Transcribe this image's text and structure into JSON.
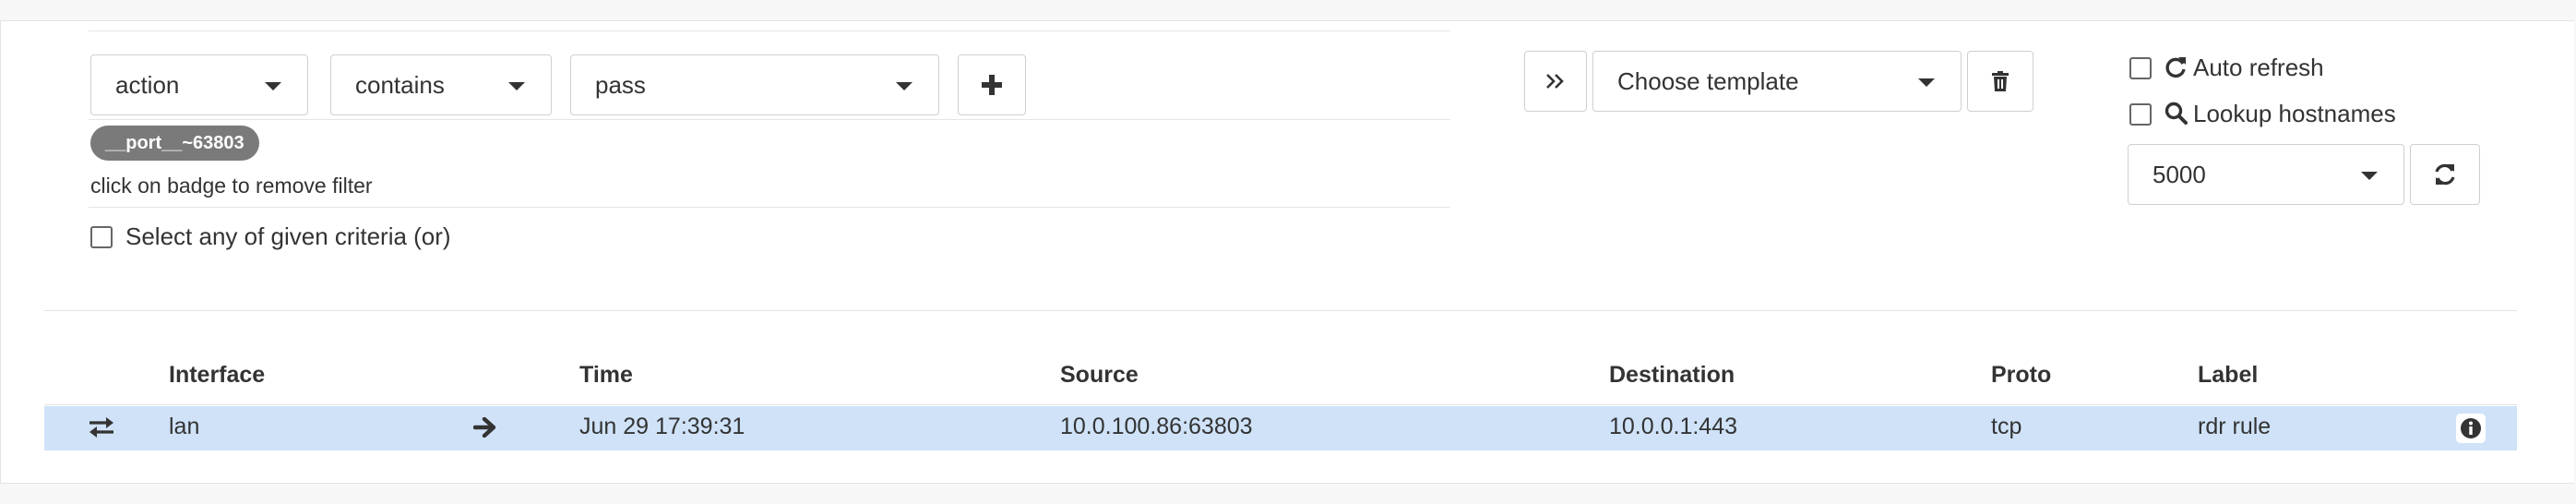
{
  "filters": {
    "field_select": "action",
    "operator_select": "contains",
    "value_select": "pass",
    "active_badge": "__port__~63803",
    "badge_hint": "click on badge to remove filter",
    "or_criteria_label": "Select any of given criteria (or)"
  },
  "templates": {
    "placeholder": "Choose template"
  },
  "options": {
    "auto_refresh_label": "Auto refresh",
    "lookup_hostnames_label": "Lookup hostnames",
    "limit_select": "5000"
  },
  "table": {
    "columns": [
      "Interface",
      "Time",
      "Source",
      "Destination",
      "Proto",
      "Label"
    ],
    "rows": [
      {
        "interface": "lan",
        "direction": "arrow-right-icon",
        "time": "Jun 29 17:39:31",
        "source": "10.0.100.86:63803",
        "destination": "10.0.0.1:443",
        "proto": "tcp",
        "label": "rdr rule",
        "highlight_color": "#cfe2f8"
      }
    ]
  },
  "colors": {
    "badge": "#7a7a7a",
    "selected_row": "#cfe2f8"
  }
}
